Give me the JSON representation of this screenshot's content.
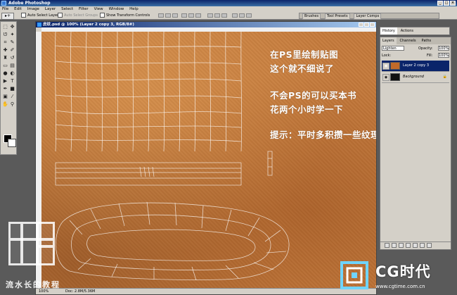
{
  "app": {
    "title": "Adobe Photoshop",
    "window_buttons": [
      "_",
      "□",
      "×"
    ]
  },
  "menubar": {
    "items": [
      "File",
      "Edit",
      "Image",
      "Layer",
      "Select",
      "Filter",
      "View",
      "Window",
      "Help"
    ]
  },
  "options_bar": {
    "tool_glyph": "▸+",
    "auto_select_layer": "Auto Select Layer",
    "auto_select_groups": "Auto Select Groups",
    "show_transform_controls": "Show Transform Controls"
  },
  "palette_well": {
    "tabs": [
      "Brushes",
      "Tool Presets",
      "Layer Comps"
    ]
  },
  "document": {
    "title": "皮纹.psd @ 100% (Layer 2 copy 3, RGB/8#)",
    "zoom": "100%",
    "doc_size": "Doc: 2.8M/5.36M"
  },
  "overlay_text": {
    "line1": "在PS里绘制贴图",
    "line2": "这个就不细说了",
    "line3": "不会PS的可以买本书",
    "line4": "花两个小时学一下",
    "line5": "提示：平时多积攒一些纹理贴图"
  },
  "history_panel": {
    "tabs": [
      "History",
      "Actions"
    ]
  },
  "layers_panel": {
    "tabs": [
      "Layers",
      "Channels",
      "Paths"
    ],
    "blend_mode": "Lighten",
    "opacity_label": "Opacity:",
    "opacity_value": "100%",
    "lock_label": "Lock:",
    "fill_label": "Fill:",
    "fill_value": "100%",
    "layers": [
      {
        "name": "Layer 2 copy 3",
        "selected": true,
        "thumb_color": "#c06a2a"
      },
      {
        "name": "Background",
        "selected": false,
        "thumb_color": "#111111"
      }
    ]
  },
  "watermark_left": {
    "caption": "流水长的教程"
  },
  "watermark_right": {
    "brand": "CG时代",
    "url": "www.cgtime.com.cn"
  },
  "colors": {
    "leather": "#c57a3b",
    "title_blue": "#0a246a",
    "chrome": "#d4d0c8"
  }
}
